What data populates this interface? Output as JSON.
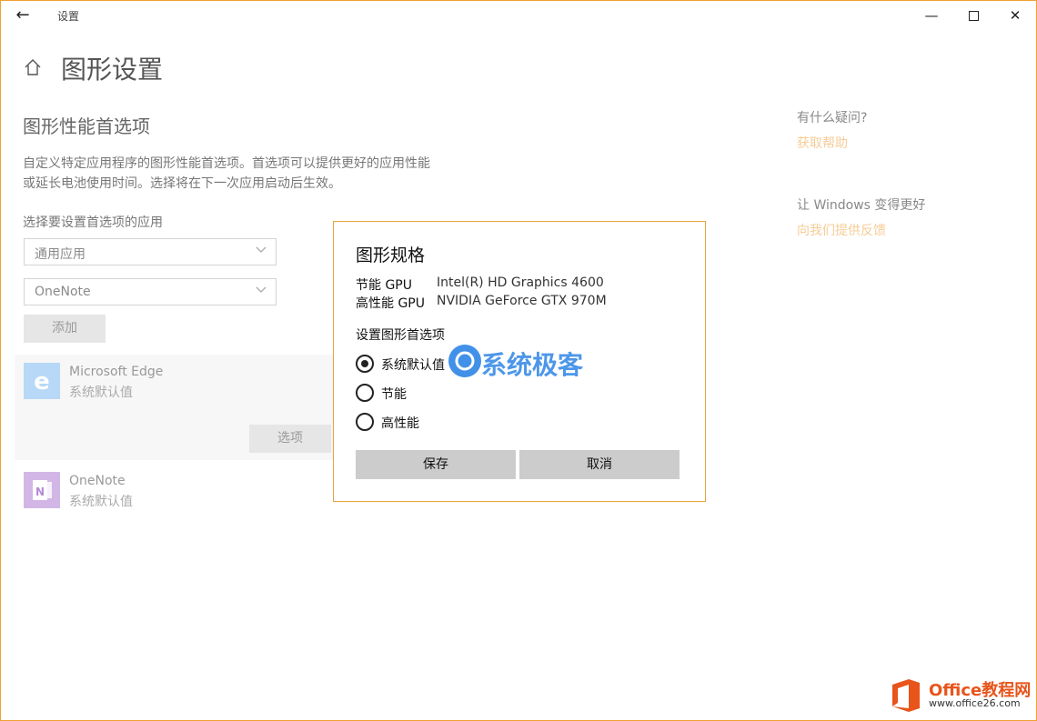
{
  "window": {
    "title": "设置"
  },
  "page": {
    "title": "图形设置",
    "section_title": "图形性能首选项",
    "description": "自定义特定应用程序的图形性能首选项。首选项可以提供更好的应用性能或延长电池使用时间。选择将在下一次应用启动后生效。",
    "choose_label": "选择要设置首选项的应用",
    "app_type_dropdown": "通用应用",
    "app_dropdown": "OneNote",
    "add_button": "添加"
  },
  "apps": [
    {
      "name": "Microsoft Edge",
      "pref": "系统默认值",
      "icon": "edge-icon"
    },
    {
      "name": "OneNote",
      "pref": "系统默认值",
      "icon": "onenote-icon"
    }
  ],
  "options_button": "选项",
  "right_pane": {
    "help_question": "有什么疑问?",
    "help_link": "获取帮助",
    "better_question": "让 Windows 变得更好",
    "feedback_link": "向我们提供反馈"
  },
  "dialog": {
    "title": "图形规格",
    "power_saving_label": "节能 GPU",
    "power_saving_value": "Intel(R) HD Graphics 4600",
    "high_perf_label": "高性能 GPU",
    "high_perf_value": "NVIDIA GeForce GTX 970M",
    "pref_label": "设置图形首选项",
    "options": [
      "系统默认值",
      "节能",
      "高性能"
    ],
    "selected_index": 0,
    "save_button": "保存",
    "cancel_button": "取消"
  },
  "watermark": {
    "text": "系统极客"
  },
  "office_watermark": {
    "line1": "Office教程网",
    "line2": "www.office26.com"
  },
  "colors": {
    "accent": "#e8a33c",
    "link": "#f6cc96"
  }
}
